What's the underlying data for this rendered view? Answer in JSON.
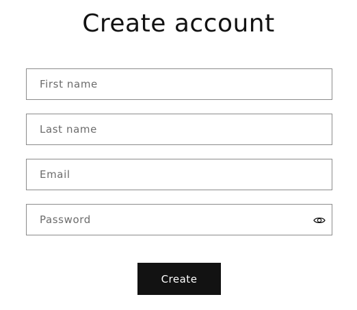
{
  "page": {
    "title": "Create account"
  },
  "form": {
    "first_name": {
      "placeholder": "First name",
      "value": ""
    },
    "last_name": {
      "placeholder": "Last name",
      "value": ""
    },
    "email": {
      "placeholder": "Email",
      "value": ""
    },
    "password": {
      "placeholder": "Password",
      "value": "",
      "toggle_icon": "eye-icon"
    },
    "submit_label": "Create"
  },
  "colors": {
    "text": "#121212",
    "border": "#8a8a8a",
    "placeholder": "#6b6b6b",
    "button_bg": "#121212",
    "button_text": "#ffffff"
  }
}
